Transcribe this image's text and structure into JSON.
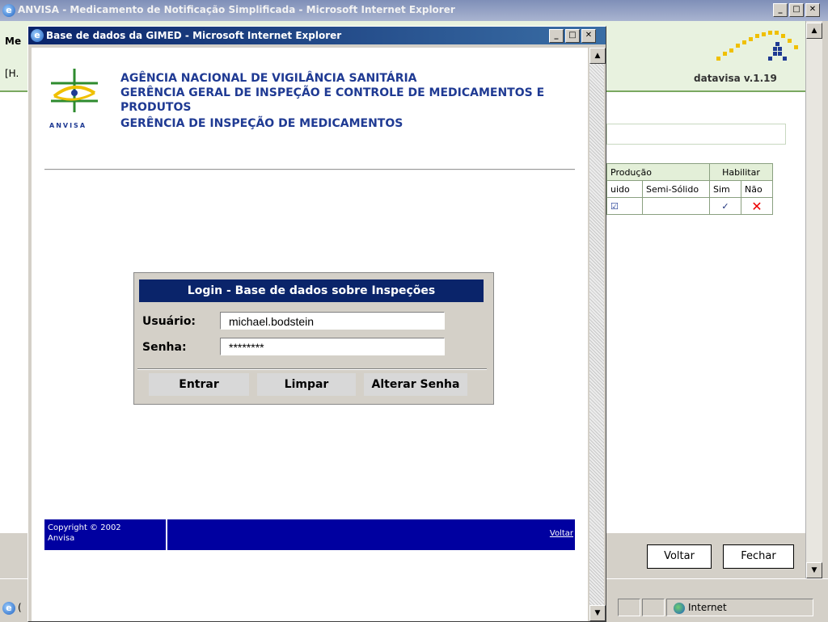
{
  "outer_window": {
    "title": "ANVISA - Medicamento de Notificação Simplificada - Microsoft Internet Explorer",
    "left_fragment_1": "Me",
    "left_fragment_2": "[H.",
    "logo_version": "datavisa v.1.19",
    "table": {
      "group_headers": [
        "Produção",
        "Habilitar"
      ],
      "sub_headers": [
        "uido",
        "Semi-Sólido",
        "Sim",
        "Não"
      ],
      "row": {
        "cell_1": "☑",
        "cell_2": "",
        "sim": "✓",
        "nao": "✕"
      }
    },
    "buttons": {
      "voltar": "Voltar",
      "fechar": "Fechar"
    },
    "status": {
      "left_fragment": "(",
      "zone": "Internet"
    }
  },
  "popup": {
    "title": "Base de dados da GIMED - Microsoft Internet Explorer",
    "logo_text": "ANVISA",
    "agency_lines": [
      "AGÊNCIA NACIONAL DE VIGILÂNCIA SANITÁRIA",
      "GERÊNCIA GERAL DE INSPEÇÃO E CONTROLE DE MEDICAMENTOS E",
      "PRODUTOS",
      "GERÊNCIA DE INSPEÇÃO DE MEDICAMENTOS"
    ],
    "login": {
      "heading": "Login - Base de dados sobre Inspeções",
      "user_label": "Usuário:",
      "user_value": "michael.bodstein",
      "password_label": "Senha:",
      "password_value": "********",
      "buttons": {
        "enter": "Entrar",
        "clear": "Limpar",
        "change_password": "Alterar Senha"
      }
    },
    "footer": {
      "copyright": "Copyright © 2002\nAnvisa",
      "back_link": "Voltar"
    }
  },
  "colors": {
    "header_blue": "#0a246a",
    "footer_blue": "#0000a0",
    "agency_text": "#1f3a93",
    "logo_green": "#2e8b2e",
    "logo_yellow": "#f0c000"
  }
}
